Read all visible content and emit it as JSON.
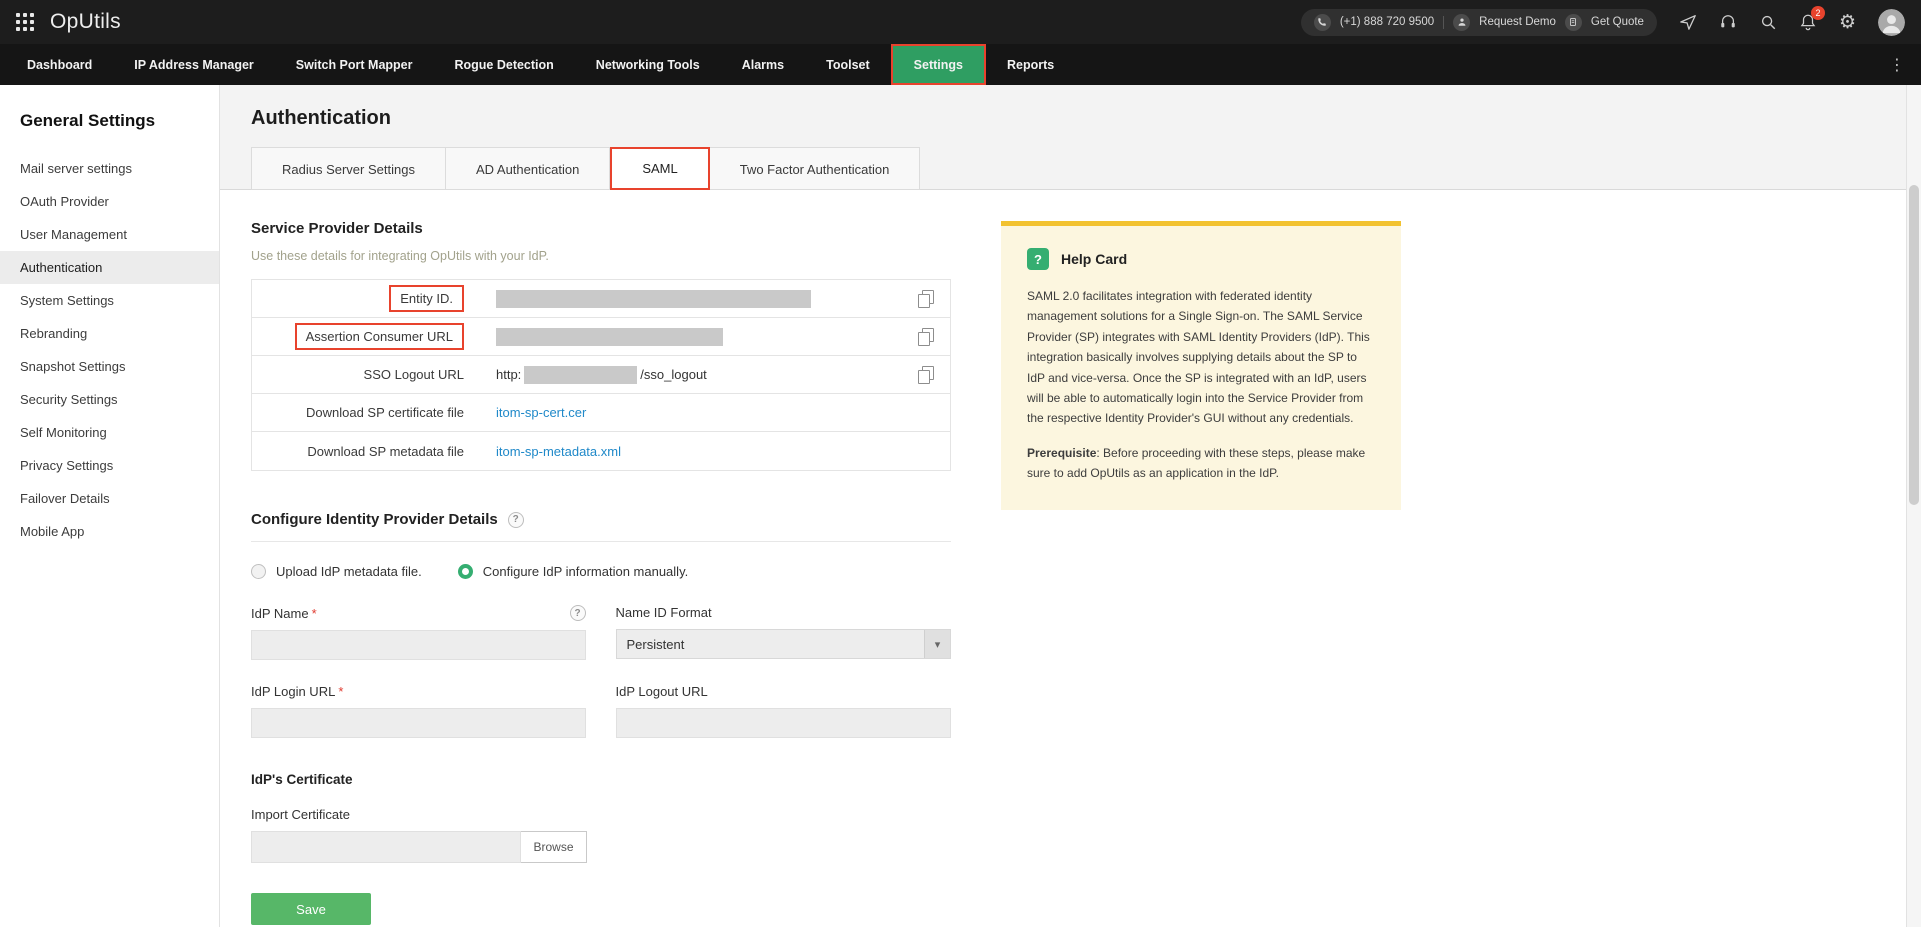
{
  "header": {
    "app_title": "OpUtils",
    "phone_number": "(+1) 888 720 9500",
    "request_demo_label": "Request Demo",
    "get_quote_label": "Get Quote",
    "notification_count": "2"
  },
  "nav": {
    "items": [
      {
        "label": "Dashboard"
      },
      {
        "label": "IP Address Manager"
      },
      {
        "label": "Switch Port Mapper"
      },
      {
        "label": "Rogue Detection"
      },
      {
        "label": "Networking Tools"
      },
      {
        "label": "Alarms"
      },
      {
        "label": "Toolset"
      },
      {
        "label": "Settings"
      },
      {
        "label": "Reports"
      }
    ],
    "active_item": "Settings"
  },
  "sidebar": {
    "heading": "General Settings",
    "items": [
      "Mail server settings",
      "OAuth Provider",
      "User Management",
      "Authentication",
      "System Settings",
      "Rebranding",
      "Snapshot Settings",
      "Security Settings",
      "Self Monitoring",
      "Privacy Settings",
      "Failover Details",
      "Mobile App"
    ],
    "active_item": "Authentication"
  },
  "main": {
    "title": "Authentication",
    "tabs": [
      "Radius Server Settings",
      "AD Authentication",
      "SAML",
      "Two Factor Authentication"
    ],
    "active_tab": "SAML",
    "sp": {
      "heading": "Service Provider Details",
      "subtitle": "Use these details for integrating OpUtils with your IdP.",
      "rows": [
        {
          "label": "Entity ID."
        },
        {
          "label": "Assertion Consumer URL"
        },
        {
          "label": "SSO Logout URL",
          "value_prefix": "http:",
          "value_suffix": "/sso_logout"
        },
        {
          "label": "Download SP certificate file",
          "link": "itom-sp-cert.cer"
        },
        {
          "label": "Download SP metadata file",
          "link": "itom-sp-metadata.xml"
        }
      ]
    },
    "idp": {
      "heading": "Configure Identity Provider Details",
      "radios": [
        {
          "label": "Upload IdP metadata file.",
          "selected": false
        },
        {
          "label": "Configure IdP information manually.",
          "selected": true
        }
      ],
      "idp_name_label": "IdP Name",
      "name_id_format_label": "Name ID Format",
      "name_id_format_value": "Persistent",
      "idp_login_url_label": "IdP Login URL",
      "idp_logout_url_label": "IdP Logout URL",
      "certificate_heading": "IdP's Certificate",
      "import_certificate_label": "Import Certificate",
      "browse_label": "Browse",
      "save_label": "Save",
      "required_marker": "*"
    },
    "help": {
      "title": "Help Card",
      "icon_glyph": "?",
      "body": "SAML 2.0 facilitates integration with federated identity management solutions for a Single Sign-on. The SAML Service Provider (SP) integrates with SAML Identity Providers (IdP). This integration basically involves supplying details about the SP to IdP and vice-versa. Once the SP is integrated with an IdP, users will be able to automatically login into the Service Provider from the respective Identity Provider's GUI without any credentials.",
      "prerequisite_label": "Prerequisite",
      "prerequisite_text": ": Before proceeding with these steps, please make sure to add OpUtils as an application in the IdP."
    }
  },
  "icons": {
    "help_glyph": "?",
    "chevron_down": "▾",
    "more_vertical": "⋮",
    "gear": "⚙"
  },
  "colors": {
    "accent_green": "#2f9e62",
    "annotation_red": "#e8432d",
    "link_blue": "#2089c9",
    "help_card_bg": "#fcf6df",
    "help_card_border": "#f2c230"
  }
}
